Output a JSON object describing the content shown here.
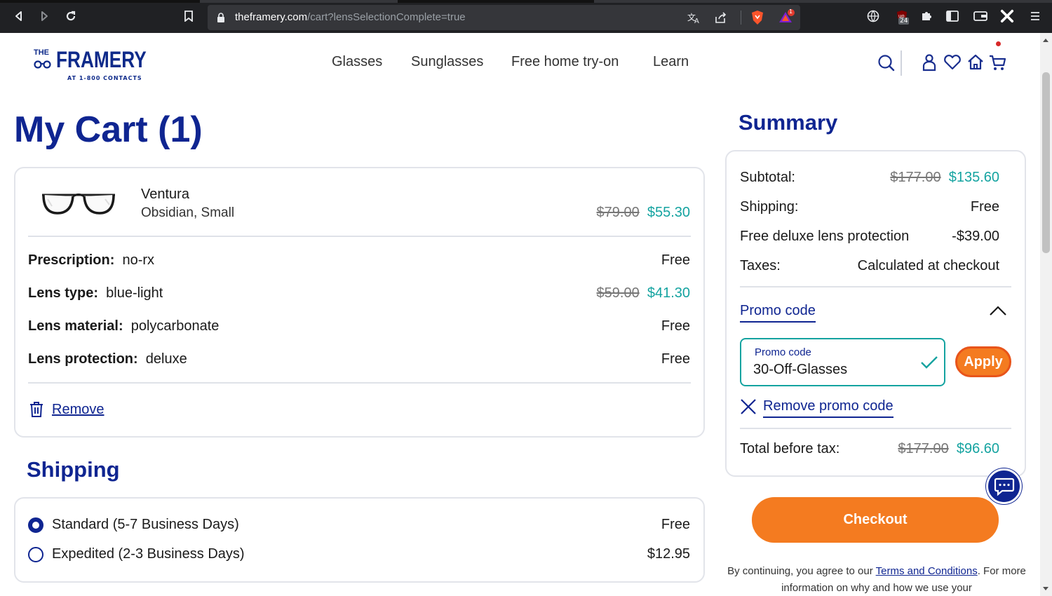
{
  "browser": {
    "url_host": "theframery.com",
    "url_path": "/cart?lensSelectionComplete=true",
    "ext_badge_brave_count": "1",
    "ext_badge_ublock_count": "24"
  },
  "header": {
    "logo_the": "THE",
    "logo_word": "FRAMERY",
    "logo_tagline": "AT 1-800 CONTACTS",
    "nav": [
      "Glasses",
      "Sunglasses",
      "Free home try-on",
      "Learn"
    ]
  },
  "cart": {
    "title": "My Cart (1)",
    "item": {
      "name": "Ventura",
      "variant": "Obsidian, Small",
      "price_original": "$79.00",
      "price_sale": "$55.30"
    },
    "options": [
      {
        "label": "Prescription:",
        "value": "no-rx",
        "price": "Free"
      },
      {
        "label": "Lens type:",
        "value": "blue-light",
        "price_original": "$59.00",
        "price": "$41.30"
      },
      {
        "label": "Lens material:",
        "value": "polycarbonate",
        "price": "Free"
      },
      {
        "label": "Lens protection:",
        "value": "deluxe",
        "price": "Free"
      }
    ],
    "remove_label": "Remove"
  },
  "shipping": {
    "title": "Shipping",
    "options": [
      {
        "label": "Standard (5-7 Business Days)",
        "price": "Free",
        "selected": true
      },
      {
        "label": "Expedited (2-3 Business Days)",
        "price": "$12.95",
        "selected": false
      }
    ]
  },
  "summary": {
    "title": "Summary",
    "subtotal_label": "Subtotal:",
    "subtotal_original": "$177.00",
    "subtotal_sale": "$135.60",
    "shipping_label": "Shipping:",
    "shipping_value": "Free",
    "protection_label": "Free deluxe lens protection",
    "protection_value": "-$39.00",
    "taxes_label": "Taxes:",
    "taxes_value": "Calculated at checkout",
    "promo_toggle_label": "Promo code",
    "promo_input_label": "Promo code",
    "promo_input_value": "30-Off-Glasses",
    "apply_label": "Apply",
    "remove_promo_label": "Remove promo code",
    "total_label": "Total before tax:",
    "total_original": "$177.00",
    "total_sale": "$96.60",
    "checkout_label": "Checkout",
    "fineprint_pre": "By continuing, you agree to our ",
    "fineprint_link": "Terms and Conditions",
    "fineprint_post": ". For more information on why and how we use your"
  },
  "colors": {
    "brand_navy": "#0f2591",
    "accent_orange": "#f47b20",
    "sale_teal": "#14a3a0"
  }
}
